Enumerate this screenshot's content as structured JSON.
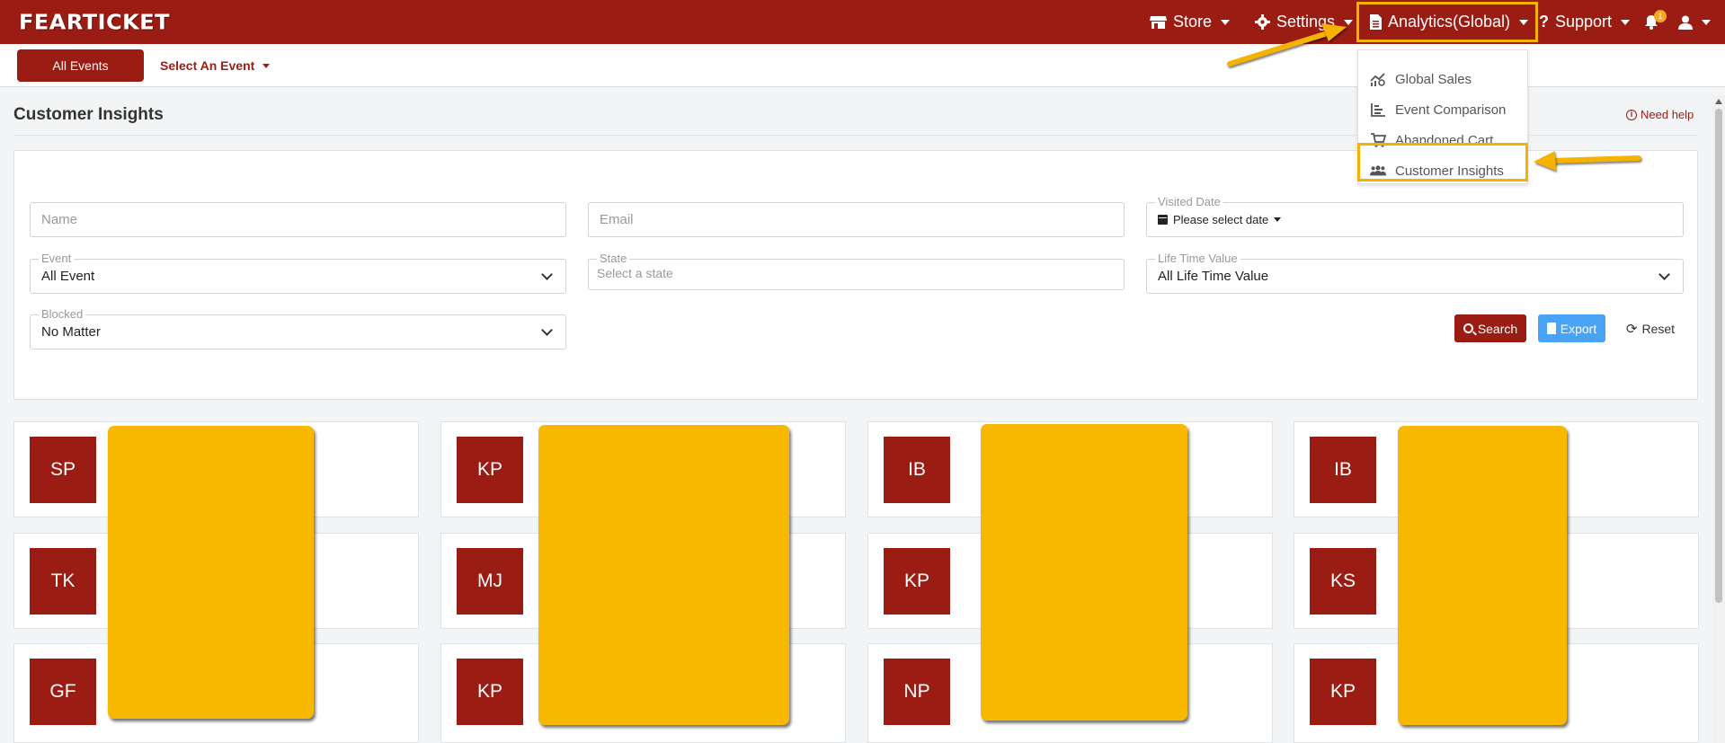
{
  "brand": {
    "logo_text": "FEARTICKET",
    "primary_color": "#9b1c13",
    "accent_color": "#f5b300"
  },
  "navbar": {
    "store": {
      "icon": "store-icon",
      "label": "Store"
    },
    "settings": {
      "icon": "gear-icon",
      "label": "Settings"
    },
    "analytics": {
      "icon": "document-icon",
      "label": "Analytics(Global)"
    },
    "support": {
      "icon": "question-icon",
      "label": "Support"
    },
    "notifications": {
      "icon": "bell-icon",
      "count": "1"
    },
    "user": {
      "icon": "user-icon"
    }
  },
  "analytics_menu": {
    "items": [
      {
        "icon": "chart-up-icon",
        "label": "Global Sales"
      },
      {
        "icon": "bar-chart-icon",
        "label": "Event Comparison"
      },
      {
        "icon": "cart-icon",
        "label": "Abandoned Cart"
      },
      {
        "icon": "users-icon",
        "label": "Customer Insights"
      }
    ]
  },
  "subbar": {
    "all_events_label": "All Events",
    "select_event_label": "Select An Event"
  },
  "page": {
    "title": "Customer Insights",
    "need_help": "Need help"
  },
  "filters": {
    "name_placeholder": "Name",
    "email_placeholder": "Email",
    "visited_date": {
      "label": "Visited Date",
      "value": "Please select date"
    },
    "event": {
      "label": "Event",
      "value": "All Event"
    },
    "state": {
      "label": "State",
      "placeholder": "Select a state"
    },
    "life_time_value": {
      "label": "Life Time Value",
      "value": "All Life Time Value"
    },
    "blocked": {
      "label": "Blocked",
      "value": "No Matter"
    },
    "search_label": "Search",
    "export_label": "Export",
    "reset_label": "Reset"
  },
  "customers": {
    "row1": [
      "SP",
      "KP",
      "IB",
      "IB"
    ],
    "row2": [
      "TK",
      "MJ",
      "KP",
      "KS"
    ],
    "row3": [
      "GF",
      "KP",
      "NP",
      "KP"
    ]
  }
}
